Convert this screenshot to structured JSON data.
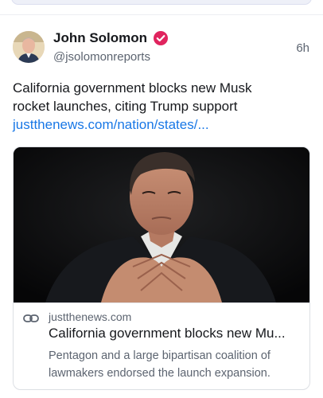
{
  "post": {
    "author_name": "John Solomon",
    "author_handle": "@jsolomonreports",
    "timestamp": "6h",
    "verified": true,
    "text_lines": [
      "California government blocks new Musk",
      "rocket launches, citing Trump support"
    ],
    "link_text": "justthenews.com/nation/states/...",
    "link_card": {
      "domain": "justthenews.com",
      "title": "California government blocks new Mu...",
      "description_lines": [
        "Pentagon and a large bipartisan coalition of",
        "lawmakers endorsed the launch expansion."
      ]
    }
  },
  "colors": {
    "link_blue": "#1877e6",
    "verified_badge": "#e0245e",
    "text_primary": "#16181c",
    "text_secondary": "#5c6470"
  },
  "icons": {
    "verified": "verified-badge-icon",
    "link": "link-chain-icon"
  }
}
